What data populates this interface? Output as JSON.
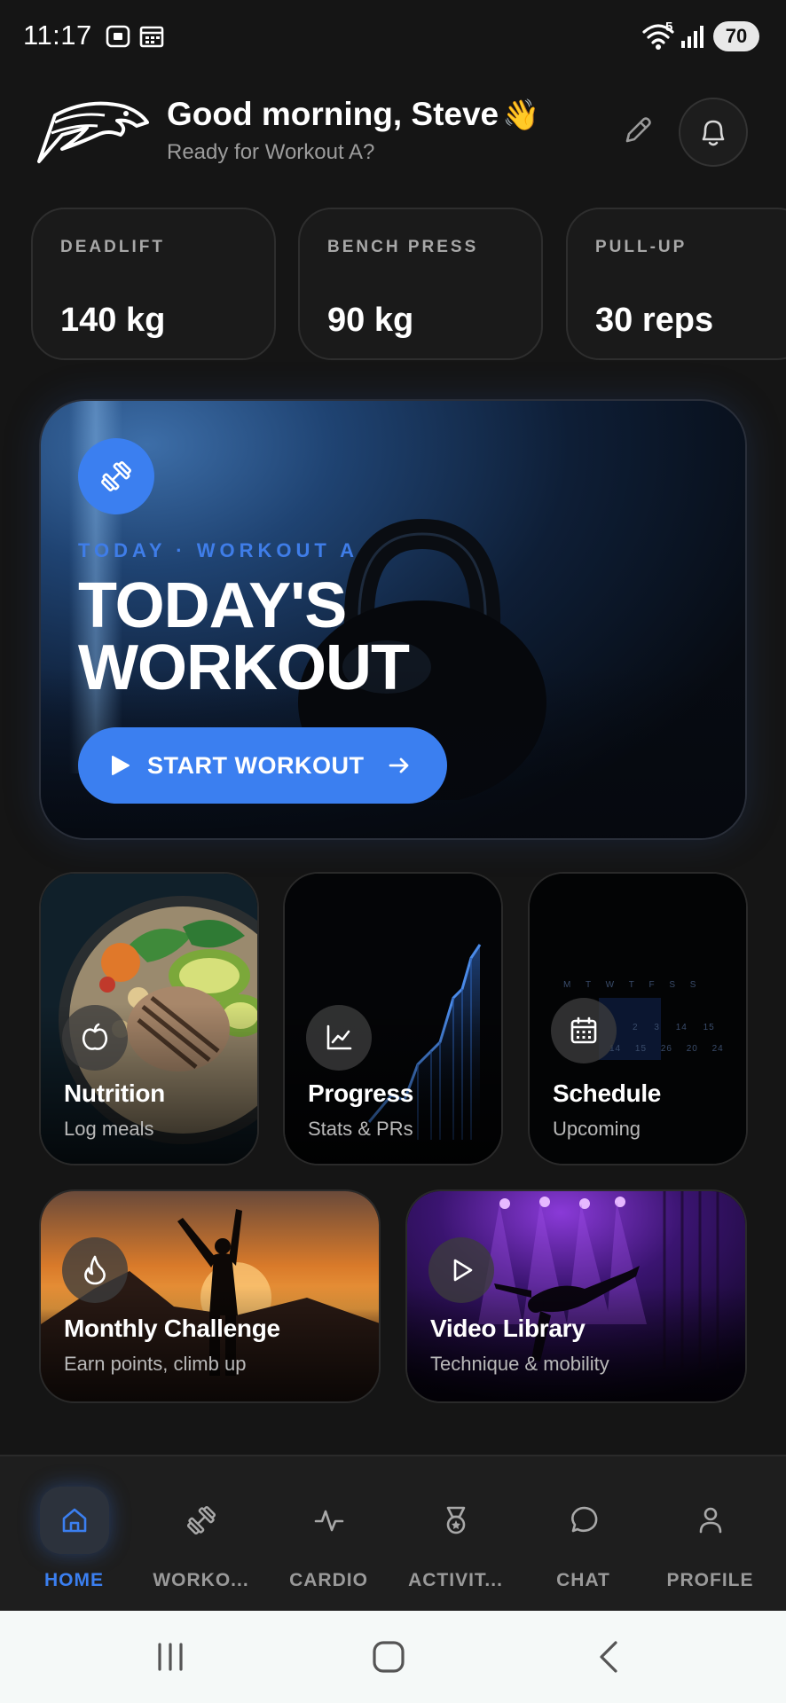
{
  "status_bar": {
    "time": "11:17",
    "battery": "70",
    "wifi_badge": "5"
  },
  "header": {
    "greeting": "Good morning, Steve",
    "wave_emoji": "👋",
    "subtitle": "Ready for Workout A?"
  },
  "stats": [
    {
      "label": "DEADLIFT",
      "value": "140 kg"
    },
    {
      "label": "BENCH PRESS",
      "value": "90 kg"
    },
    {
      "label": "PULL-UP",
      "value": "30 reps"
    }
  ],
  "hero": {
    "kicker": "TODAY · WORKOUT A",
    "title": "TODAY'S WORKOUT",
    "button_label": "START WORKOUT"
  },
  "tiles": {
    "nutrition": {
      "title": "Nutrition",
      "subtitle": "Log meals",
      "icon": "apple-icon"
    },
    "progress": {
      "title": "Progress",
      "subtitle": "Stats & PRs",
      "icon": "line-chart-icon"
    },
    "schedule": {
      "title": "Schedule",
      "subtitle": "Upcoming",
      "icon": "calendar-icon"
    },
    "challenge": {
      "title": "Monthly Challenge",
      "subtitle": "Earn points, climb up",
      "icon": "flame-icon"
    },
    "video": {
      "title": "Video Library",
      "subtitle": "Technique & mobility",
      "icon": "play-icon"
    }
  },
  "schedule_calendar": {
    "weekdays": [
      "M",
      "T",
      "W",
      "T",
      "F",
      "S",
      "S"
    ],
    "row1": [
      "2",
      "3",
      "14",
      "15"
    ],
    "row2": [
      "14",
      "15",
      "26",
      "20",
      "24"
    ]
  },
  "bottom_nav": [
    {
      "label": "HOME",
      "icon": "home-icon",
      "active": true
    },
    {
      "label": "WORKO...",
      "icon": "dumbbell-icon",
      "active": false
    },
    {
      "label": "CARDIO",
      "icon": "activity-icon",
      "active": false
    },
    {
      "label": "ACTIVIT...",
      "icon": "medal-icon",
      "active": false
    },
    {
      "label": "CHAT",
      "icon": "chat-icon",
      "active": false
    },
    {
      "label": "PROFILE",
      "icon": "user-icon",
      "active": false
    }
  ],
  "colors": {
    "accent": "#3b7ff0",
    "background": "#151515",
    "card": "#1a1a1a"
  }
}
